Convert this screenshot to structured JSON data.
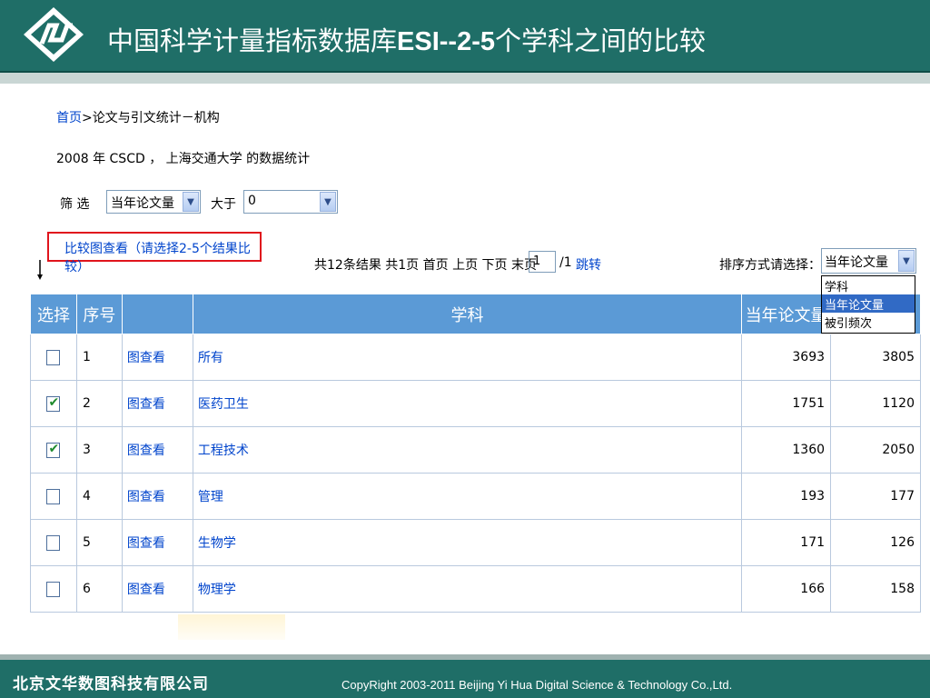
{
  "header": {
    "title_prefix": "中国科学计量指标数据库",
    "title_bold": "ESI--2-5",
    "title_suffix": "个学科之间的比较"
  },
  "breadcrumb": {
    "home": "首页",
    "separator": ">",
    "current": "论文与引文统计－机构"
  },
  "stat_line": "2008 年 CSCD ， 上海交通大学 的数据统计",
  "filter": {
    "label": "筛 选",
    "field_value": "当年论文量",
    "operator_label": "大于",
    "threshold_value": "0"
  },
  "compare_button": "比较图查看（请选择2-5个结果比较）",
  "pager": {
    "summary": "共12条结果 共1页 首页 上页 下页 末页",
    "page_value": "1",
    "total": "/1",
    "jump": "跳转"
  },
  "sort": {
    "label": "排序方式请选择：",
    "selected": "当年论文量",
    "options": [
      "学科",
      "当年论文量",
      "被引频次"
    ]
  },
  "table": {
    "headers": [
      "选择",
      "序号",
      "",
      "学科",
      "当年论文量",
      ""
    ],
    "view_label": "图查看",
    "rows": [
      {
        "checked": false,
        "num": "1",
        "subject": "所有",
        "papers": "3693",
        "citations": "3805"
      },
      {
        "checked": true,
        "num": "2",
        "subject": "医药卫生",
        "papers": "1751",
        "citations": "1120"
      },
      {
        "checked": true,
        "num": "3",
        "subject": "工程技术",
        "papers": "1360",
        "citations": "2050"
      },
      {
        "checked": false,
        "num": "4",
        "subject": "管理",
        "papers": "193",
        "citations": "177"
      },
      {
        "checked": false,
        "num": "5",
        "subject": "生物学",
        "papers": "171",
        "citations": "126"
      },
      {
        "checked": false,
        "num": "6",
        "subject": "物理学",
        "papers": "166",
        "citations": "158"
      }
    ]
  },
  "footer": {
    "brand": "北京文华数图科技有限公司",
    "copyright": "CopyRight 2003-2011 Beijing Yi Hua Digital Science & Technology Co.,Ltd."
  },
  "colors": {
    "header_bg": "#1f6e67",
    "table_header_bg": "#5b9ad6",
    "link": "#0044cc",
    "highlight_border": "#e0141c"
  }
}
